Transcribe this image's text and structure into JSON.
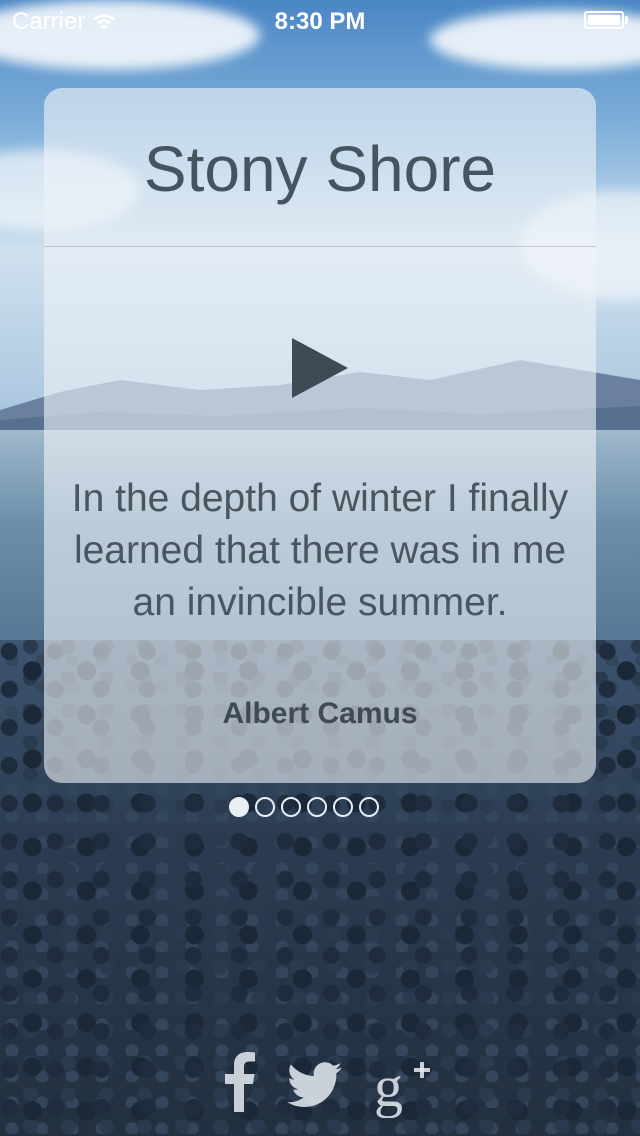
{
  "status_bar": {
    "carrier": "Carrier",
    "time": "8:30 PM",
    "wifi_icon": "wifi-icon",
    "battery_icon": "battery-icon",
    "battery_level": 1.0
  },
  "card": {
    "title": "Stony Shore",
    "play_icon": "play-icon",
    "quote": "In the depth of winter I finally learned that there was in me an invincible summer.",
    "author": "Albert Camus"
  },
  "pagination": {
    "total": 6,
    "current": 1
  },
  "social": {
    "icons": [
      "facebook-icon",
      "twitter-icon",
      "google-plus-icon"
    ]
  },
  "colors": {
    "card_background": "#eef2f7",
    "title_text": "#46545f",
    "quote_text": "#4a565f",
    "play_icon": "#3f4a52",
    "dots": "#e8eef4"
  }
}
